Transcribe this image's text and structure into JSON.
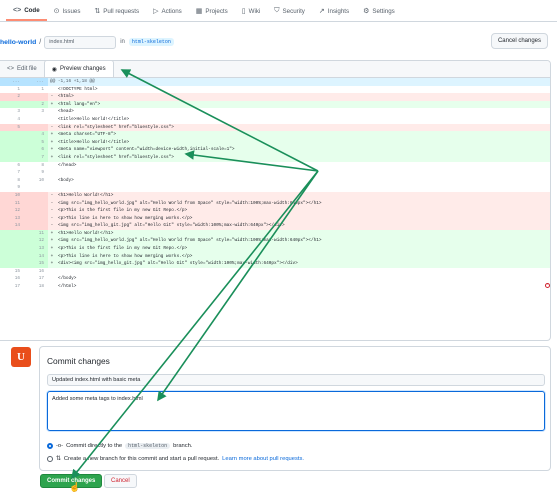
{
  "nav": {
    "tabs": [
      {
        "icon": "<>",
        "label": "Code"
      },
      {
        "icon": "⊙",
        "label": "Issues"
      },
      {
        "icon": "⇅",
        "label": "Pull requests"
      },
      {
        "icon": "▷",
        "label": "Actions"
      },
      {
        "icon": "▦",
        "label": "Projects"
      },
      {
        "icon": "▯",
        "label": "Wiki"
      },
      {
        "icon": "⛉",
        "label": "Security"
      },
      {
        "icon": "↗",
        "label": "Insights"
      },
      {
        "icon": "⚙",
        "label": "Settings"
      }
    ]
  },
  "path": {
    "repo": "hello-world",
    "separator": "/",
    "filename": "index.html",
    "in_label": "in",
    "branch": "html-skeleton",
    "cancel_label": "Cancel changes"
  },
  "editor": {
    "edit_tab": "Edit file",
    "preview_tab": "Preview changes",
    "hunk": "@@ -1,16 +1,18 @@",
    "lines": [
      {
        "t": "ctx",
        "o": "1",
        "n": "1",
        "m": "",
        "c": "<!DOCTYPE html>"
      },
      {
        "t": "del",
        "o": "2",
        "n": "",
        "m": "-",
        "c": "<html>"
      },
      {
        "t": "add",
        "o": "",
        "n": "2",
        "m": "+",
        "c": "<html lang=\"en\">"
      },
      {
        "t": "ctx",
        "o": "3",
        "n": "3",
        "m": "",
        "c": "<head>"
      },
      {
        "t": "ctx",
        "o": "4",
        "n": "",
        "m": "",
        "c": "  <title>Hello World!</title>"
      },
      {
        "t": "del",
        "o": "5",
        "n": "",
        "m": "-",
        "c": "  <link rel=\"stylesheet\" href=\"bluestyle.css\">"
      },
      {
        "t": "add",
        "o": "",
        "n": "4",
        "m": "+",
        "c": "  <meta charset=\"UTF-8\">"
      },
      {
        "t": "add",
        "o": "",
        "n": "5",
        "m": "+",
        "c": "  <title>Hello World!</title>"
      },
      {
        "t": "add",
        "o": "",
        "n": "6",
        "m": "+",
        "c": "  <meta name=\"viewport\" content=\"width=device-width,initial-scale=1\">"
      },
      {
        "t": "add",
        "o": "",
        "n": "7",
        "m": "+",
        "c": "  <link rel=\"stylesheet\" href=\"bluestyle.css\">"
      },
      {
        "t": "ctx",
        "o": "6",
        "n": "8",
        "m": "",
        "c": "</head>"
      },
      {
        "t": "ctx",
        "o": "7",
        "n": "9",
        "m": "",
        "c": ""
      },
      {
        "t": "ctx",
        "o": "8",
        "n": "10",
        "m": "",
        "c": "<body>"
      },
      {
        "t": "ctx",
        "o": "9",
        "n": "",
        "m": "",
        "c": ""
      },
      {
        "t": "del",
        "o": "10",
        "n": "",
        "m": "-",
        "c": "  <h1>Hello World!</h1>"
      },
      {
        "t": "del",
        "o": "11",
        "n": "",
        "m": "-",
        "c": "  <img src=\"img_hello_world.jpg\" alt=\"Hello World from Space\" style=\"width:100%;max-width:640px\"></h1>"
      },
      {
        "t": "del",
        "o": "12",
        "n": "",
        "m": "-",
        "c": "  <p>This is the first file in my new Git Repo.</p>"
      },
      {
        "t": "del",
        "o": "13",
        "n": "",
        "m": "-",
        "c": "  <p>This line is here to show how merging works.</p>"
      },
      {
        "t": "del",
        "o": "14",
        "n": "",
        "m": "-",
        "c": "  <img src=\"img_hello_git.jpg\" alt=\"Hello Git\" style=\"width:100%;max-width:640px\"></div>"
      },
      {
        "t": "add",
        "o": "",
        "n": "11",
        "m": "+",
        "c": "  <h1>Hello World!</h1>"
      },
      {
        "t": "add",
        "o": "",
        "n": "12",
        "m": "+",
        "c": "  <img src=\"img_hello_world.jpg\" alt=\"Hello World from Space\" style=\"width:100%;max-width:640px\"></h1>"
      },
      {
        "t": "add",
        "o": "",
        "n": "13",
        "m": "+",
        "c": "  <p>This is the first file in my new Git Repo.</p>"
      },
      {
        "t": "add",
        "o": "",
        "n": "14",
        "m": "+",
        "c": "  <p>This line is here to show how merging works.</p>"
      },
      {
        "t": "add",
        "o": "",
        "n": "15",
        "m": "+",
        "c": "  <div><img src=\"img_hello_git.jpg\" alt=\"Hello Git\" style=\"width:100%;max-width:640px\"></div>"
      },
      {
        "t": "ctx",
        "o": "15",
        "n": "16",
        "m": "",
        "c": ""
      },
      {
        "t": "ctx",
        "o": "16",
        "n": "17",
        "m": "",
        "c": "</body>"
      },
      {
        "t": "ctx",
        "o": "17",
        "n": "18",
        "m": "",
        "c": "</html>"
      }
    ]
  },
  "commit": {
    "title": "Commit changes",
    "summary": "Updated index.html with basic meta",
    "description": "Added some meta tags to index.html",
    "option_direct_before": "Commit directly to the",
    "option_direct_branch": "html-skeleton",
    "option_direct_after": "branch.",
    "option_new_branch": "Create a new branch for this commit and start a pull request.",
    "learn_more": "Learn more about pull requests.",
    "commit_button": "Commit changes",
    "cancel_button": "Cancel"
  },
  "colors": {
    "accent": "#0969da",
    "commit_green": "#2da44e",
    "annotation_arrow": "#1a8f5a",
    "avatar": "#e94e1b"
  }
}
